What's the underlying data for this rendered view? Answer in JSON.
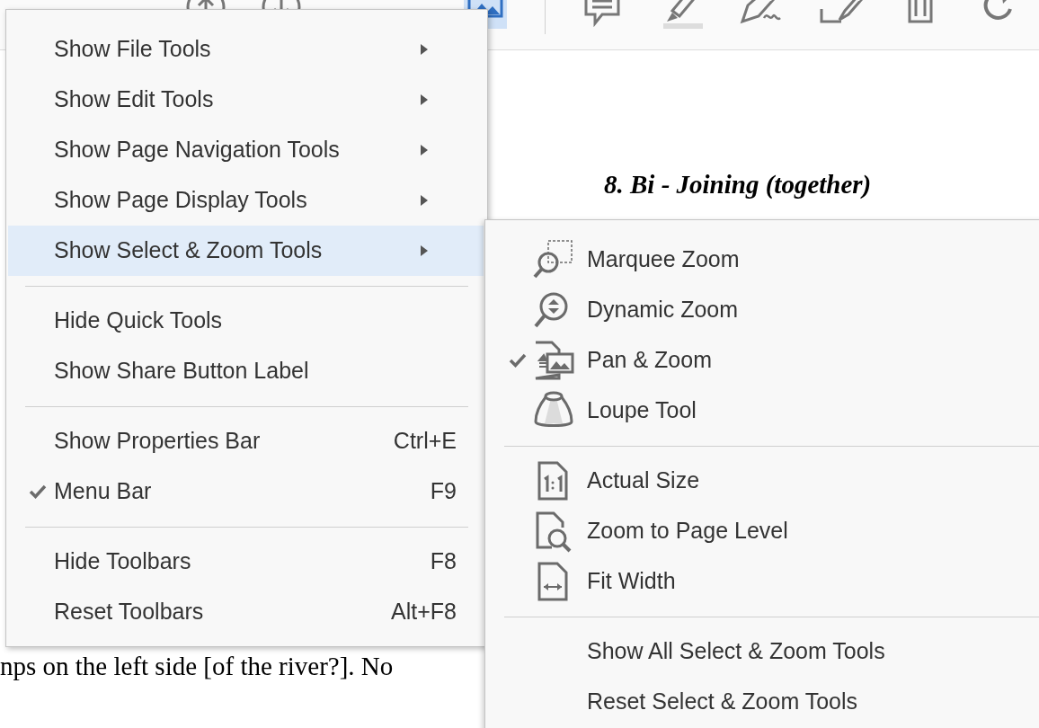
{
  "toolbar": {
    "tools": [
      {
        "kind": "up"
      },
      {
        "kind": "down"
      },
      {
        "kind": "panzoom",
        "selected": true
      },
      {
        "kind": "divider"
      },
      {
        "kind": "comment"
      },
      {
        "kind": "highlight"
      },
      {
        "kind": "sign"
      },
      {
        "kind": "edit"
      },
      {
        "kind": "trash"
      },
      {
        "kind": "rotate"
      }
    ]
  },
  "document": {
    "heading": "8. Bi - Joining (together)",
    "line": "nps on the left side [of the river?]. No"
  },
  "menu": {
    "groups": [
      [
        {
          "label": "Show File Tools",
          "submenu": true,
          "selected": false
        },
        {
          "label": "Show Edit Tools",
          "submenu": true,
          "selected": false
        },
        {
          "label": "Show Page Navigation Tools",
          "submenu": true,
          "selected": false
        },
        {
          "label": "Show Page Display Tools",
          "submenu": true,
          "selected": false
        },
        {
          "label": "Show Select & Zoom Tools",
          "submenu": true,
          "selected": true
        }
      ],
      [
        {
          "label": "Hide Quick Tools",
          "selected": false
        },
        {
          "label": "Show Share Button Label",
          "selected": false
        }
      ],
      [
        {
          "label": "Show Properties Bar",
          "shortcut": "Ctrl+E",
          "checked": false,
          "selected": false
        },
        {
          "label": "Menu Bar",
          "shortcut": "F9",
          "checked": true,
          "selected": false
        }
      ],
      [
        {
          "label": "Hide Toolbars",
          "shortcut": "F8",
          "selected": false
        },
        {
          "label": "Reset Toolbars",
          "shortcut": "Alt+F8",
          "selected": false
        }
      ]
    ]
  },
  "submenu": {
    "groups": [
      [
        {
          "label": "Marquee Zoom",
          "kind": "marquee",
          "checked": false
        },
        {
          "label": "Dynamic Zoom",
          "kind": "dynamic",
          "checked": false
        },
        {
          "label": "Pan & Zoom",
          "kind": "panzoom",
          "checked": true
        },
        {
          "label": "Loupe Tool",
          "kind": "loupe",
          "checked": false
        }
      ],
      [
        {
          "label": "Actual Size",
          "kind": "actual",
          "checked": false
        },
        {
          "label": "Zoom to Page Level",
          "kind": "pagelevel",
          "checked": false
        },
        {
          "label": "Fit Width",
          "kind": "fitwidth",
          "checked": false
        }
      ],
      [
        {
          "label": "Show All Select & Zoom Tools",
          "kind": "plain"
        },
        {
          "label": "Reset Select & Zoom Tools",
          "kind": "plain"
        }
      ]
    ]
  }
}
